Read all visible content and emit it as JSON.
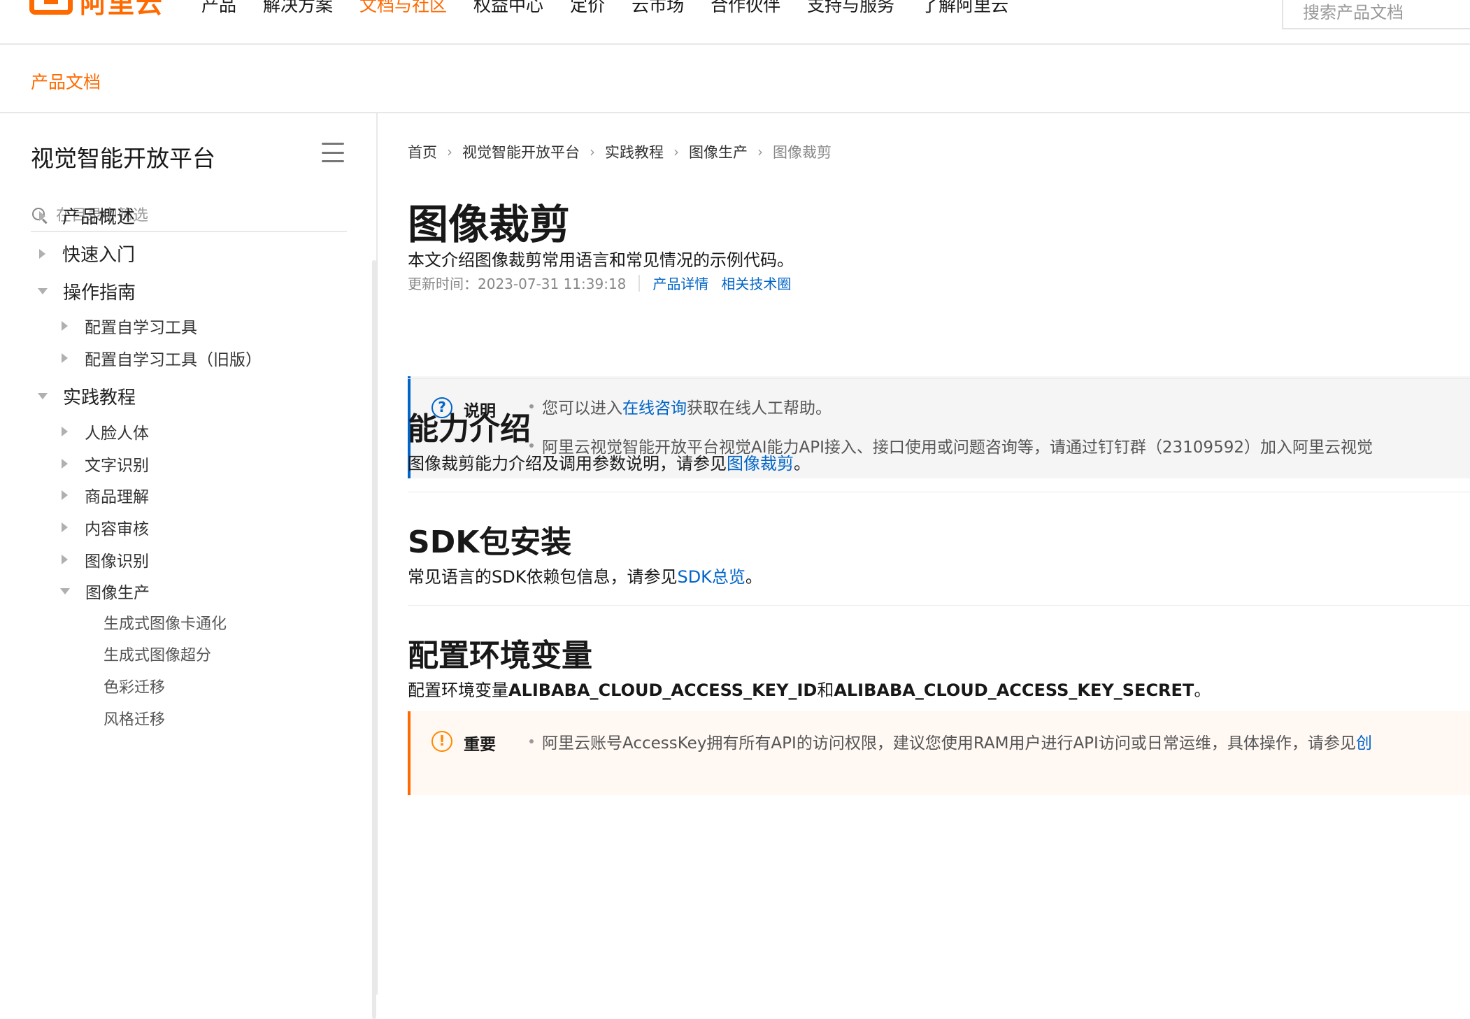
{
  "brand": {
    "logo_text": "阿里云"
  },
  "topnav": {
    "items": [
      "产品",
      "解决方案",
      "文档与社区",
      "权益中心",
      "定价",
      "云市场",
      "合作伙伴",
      "支持与服务",
      "了解阿里云"
    ],
    "active_index": 2,
    "search_placeholder": "搜索产品文档"
  },
  "subheader": {
    "title": "产品文档"
  },
  "sidebar": {
    "title": "视觉智能开放平台",
    "filter_placeholder": "在目录中筛选",
    "items": [
      {
        "label": "产品概述",
        "level": 1,
        "state": "collapsed"
      },
      {
        "label": "快速入门",
        "level": 1,
        "state": "collapsed"
      },
      {
        "label": "操作指南",
        "level": 1,
        "state": "expanded"
      },
      {
        "label": "配置自学习工具",
        "level": 2,
        "state": "collapsed"
      },
      {
        "label": "配置自学习工具（旧版）",
        "level": 2,
        "state": "collapsed"
      },
      {
        "label": "实践教程",
        "level": 1,
        "state": "expanded"
      },
      {
        "label": "人脸人体",
        "level": 2,
        "state": "collapsed"
      },
      {
        "label": "文字识别",
        "level": 2,
        "state": "collapsed"
      },
      {
        "label": "商品理解",
        "level": 2,
        "state": "collapsed"
      },
      {
        "label": "内容审核",
        "level": 2,
        "state": "collapsed"
      },
      {
        "label": "图像识别",
        "level": 2,
        "state": "collapsed"
      },
      {
        "label": "图像生产",
        "level": 2,
        "state": "expanded"
      },
      {
        "label": "生成式图像卡通化",
        "level": 3,
        "state": "leaf"
      },
      {
        "label": "生成式图像超分",
        "level": 3,
        "state": "leaf"
      },
      {
        "label": "色彩迁移",
        "level": 3,
        "state": "leaf"
      },
      {
        "label": "风格迁移",
        "level": 3,
        "state": "leaf"
      }
    ]
  },
  "breadcrumb": [
    "首页",
    "视觉智能开放平台",
    "实践教程",
    "图像生产",
    "图像裁剪"
  ],
  "article": {
    "title": "图像裁剪",
    "updated": "更新时间：2023-07-31 11:39:18",
    "meta_links": [
      "产品详情",
      "相关技术圈"
    ],
    "intro": "本文介绍图像裁剪常用语言和常见情况的示例代码。",
    "note": {
      "label": "说明",
      "item1_prefix": "您可以进入",
      "item1_link": "在线咨询",
      "item1_suffix": "获取在线人工帮助。",
      "item2": "阿里云视觉智能开放平台视觉AI能力API接入、接口使用或问题咨询等，请通过钉钉群（23109592）加入阿里云视觉"
    },
    "sections": [
      {
        "heading": "能力介绍",
        "text_prefix": "图像裁剪能力介绍及调用参数说明，请参见",
        "link": "图像裁剪",
        "text_suffix": "。"
      },
      {
        "heading": "SDK包安装",
        "text_prefix": "常见语言的SDK依赖包信息，请参见",
        "link": "SDK总览",
        "text_suffix": "。"
      },
      {
        "heading": "配置环境变量",
        "text_prefix": "配置环境变量",
        "bold1": "ALIBABA_CLOUD_ACCESS_KEY_ID",
        "mid": "和",
        "bold2": "ALIBABA_CLOUD_ACCESS_KEY_SECRET",
        "text_suffix": "。"
      }
    ],
    "important": {
      "label": "重要",
      "text": "阿里云账号AccessKey拥有所有API的访问权限，建议您使用RAM用户进行API访问或日常运维，具体操作，请参见",
      "link": "创"
    }
  },
  "colors": {
    "brand_orange": "#ff6a00",
    "link_blue": "#0064c8"
  }
}
